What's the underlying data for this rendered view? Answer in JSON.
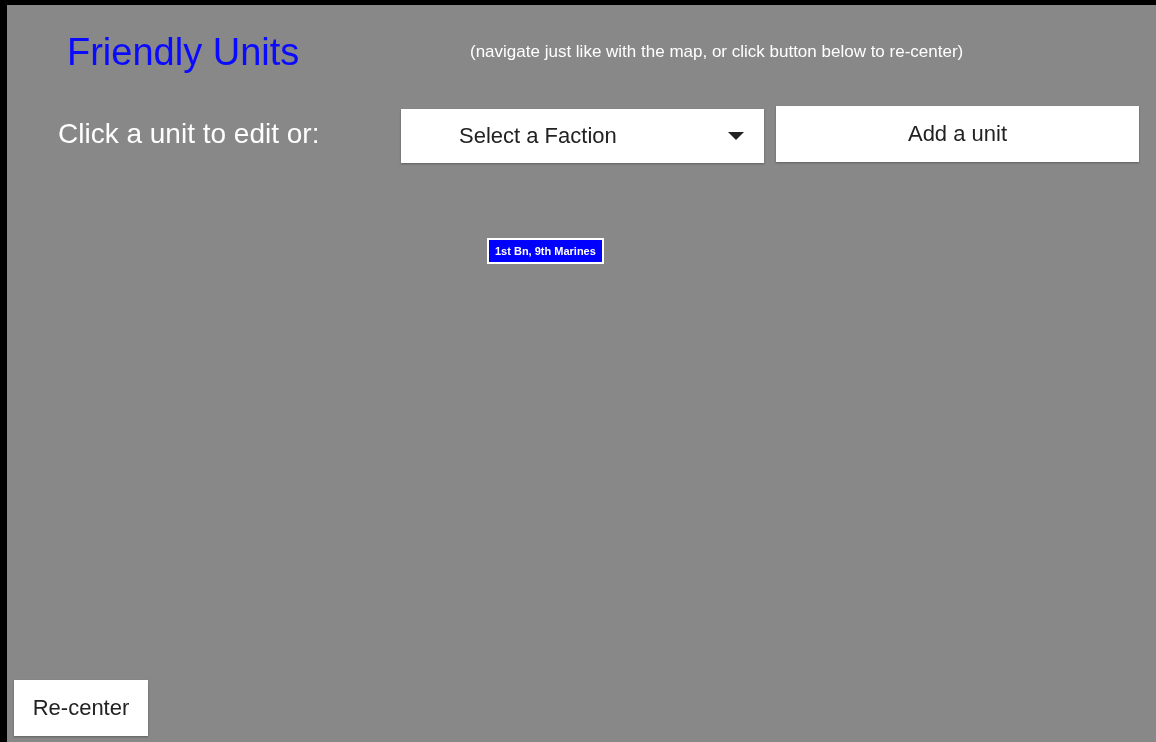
{
  "header": {
    "title": "Friendly Units",
    "hint": "(navigate just like with the map, or click button below to re-center)"
  },
  "toolbar": {
    "label": "Click a unit to edit or:",
    "faction_select": {
      "placeholder": "Select a Faction"
    },
    "add_button": "Add a unit"
  },
  "units": [
    {
      "name": "1st Bn, 9th Marines"
    }
  ],
  "recenter_button": "Re-center"
}
